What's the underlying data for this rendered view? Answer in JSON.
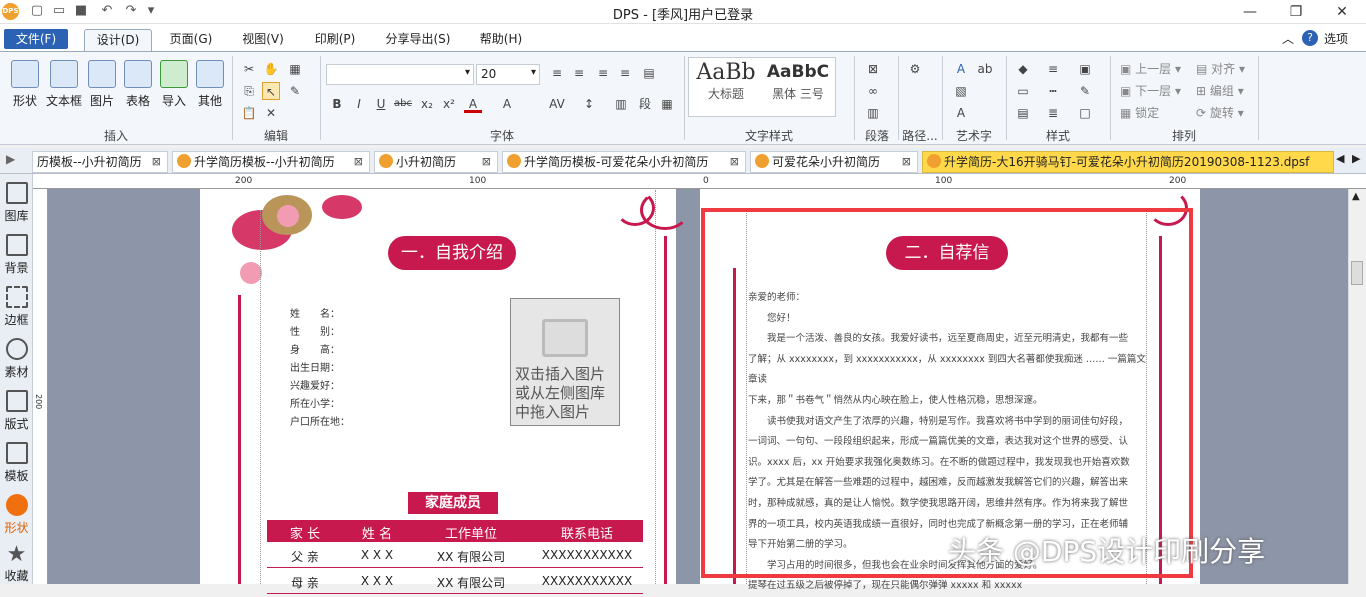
{
  "titlebar": {
    "app_logo": "DPS",
    "title": "DPS - [季风]用户已登录",
    "buttons": [
      "minimize",
      "restore",
      "close"
    ]
  },
  "menu": {
    "file": "文件(F)",
    "items": [
      "设计(D)",
      "页面(G)",
      "视图(V)",
      "印刷(P)",
      "分享导出(S)",
      "帮助(H)"
    ],
    "options": "选项"
  },
  "ribbon": {
    "insert": {
      "label": "插入",
      "buttons": [
        "形状",
        "文本框",
        "图片",
        "表格",
        "导入",
        "其他"
      ]
    },
    "edit": {
      "label": "编辑"
    },
    "font": {
      "label": "字体",
      "size": "20",
      "format_buttons": [
        "B",
        "I",
        "U",
        "abc",
        "x₂",
        "x²",
        "A",
        "A"
      ]
    },
    "text_style": {
      "label": "文字样式",
      "samples": [
        {
          "preview": "AaBb",
          "name": "大标题"
        },
        {
          "preview": "AaBbC",
          "name": "黑体 三号"
        }
      ]
    },
    "paragraph": {
      "label": "段落"
    },
    "path": {
      "label": "路径..."
    },
    "art": {
      "label": "艺术字"
    },
    "style": {
      "label": "样式"
    },
    "arrange": {
      "label": "排列",
      "buttons": [
        "上一层",
        "对齐",
        "下一层",
        "编组",
        "锁定",
        "旋转"
      ]
    }
  },
  "tabs": [
    {
      "label": "历模板--小升初简历"
    },
    {
      "label": "升学简历模板--小升初简历"
    },
    {
      "label": "小升初简历"
    },
    {
      "label": "升学简历模板-可爱花朵小升初简历"
    },
    {
      "label": "可爱花朵小升初简历"
    },
    {
      "label": "升学简历-大16开骑马钉-可爱花朵小升初简历20190308-1123.dpsf"
    }
  ],
  "sidebar": [
    "图库",
    "背景",
    "边框",
    "素材",
    "版式",
    "模板",
    "形状",
    "收藏"
  ],
  "ruler": {
    "h_ticks": [
      "200",
      "100",
      "0",
      "100",
      "200"
    ],
    "v_tick": "200"
  },
  "doc": {
    "left_banner": "一．自我介绍",
    "right_banner": "二．自荐信",
    "fields": [
      "姓　　名：",
      "性　　别：",
      "身　　高：",
      "出生日期：",
      "兴趣爱好：",
      "所在小学：",
      "户口所在地："
    ],
    "photo_placeholder": [
      "双击插入图片",
      "或从左侧图库",
      "中拖入图片"
    ],
    "family_title": "家庭成员",
    "family_headers": [
      "家 长",
      "姓 名",
      "工作单位",
      "联系电话"
    ],
    "family_rows": [
      [
        "父 亲",
        "X X X",
        "XX 有限公司",
        "XXXXXXXXXXX"
      ],
      [
        "母 亲",
        "X X X",
        "XX 有限公司",
        "XXXXXXXXXXX"
      ]
    ],
    "letter": [
      "亲爱的老师：",
      "　　您好！",
      "　　我是一个活泼、善良的女孩。我爱好读书，远至夏商周史，近至元明清史，我都有一些",
      "了解；从 xxxxxxxx，到 xxxxxxxxxxx，从 xxxxxxxx 到四大名著都使我痴迷 …… 一篇篇文章读",
      "下来，那＂书卷气＂悄然从内心映在脸上，使人性格沉稳，思想深邃。",
      "　　读书使我对语文产生了浓厚的兴趣，特别是写作。我喜欢将书中学到的丽词佳句好段，",
      "一词词、一句句、一段段组织起来，形成一篇篇优美的文章，表达我对这个世界的感受、认",
      "识。xxxx 后，xx 开始要求我强化奥数练习。在不断的做题过程中，我发现我也开始喜欢数",
      "学了。尤其是在解答一些难题的过程中，越困难，反而越激发我解答它们的兴趣，解答出来",
      "时，那种成就感，真的是让人愉悦。数学使我思路开阔，思维井然有序。作为将来我了解世",
      "界的一项工具，校内英语我成绩一直很好，同时也完成了新概念第一册的学习，正在老师辅",
      "导下开始第二册的学习。",
      "　　学习占用的时间很多，但我也会在业余时间发挥其他方面的爱好。",
      "提琴在过五级之后被停掉了，现在只能偶尔弹弹 xxxxx 和 xxxxx"
    ],
    "watermark": "头条 @DPS设计印刷分享"
  },
  "colors": {
    "accent": "#c8194e",
    "menu_blue": "#2b62b3",
    "highlight_box": "#ef3a42",
    "tab_active": "#ffd94a",
    "canvas": "#8d95a8"
  }
}
